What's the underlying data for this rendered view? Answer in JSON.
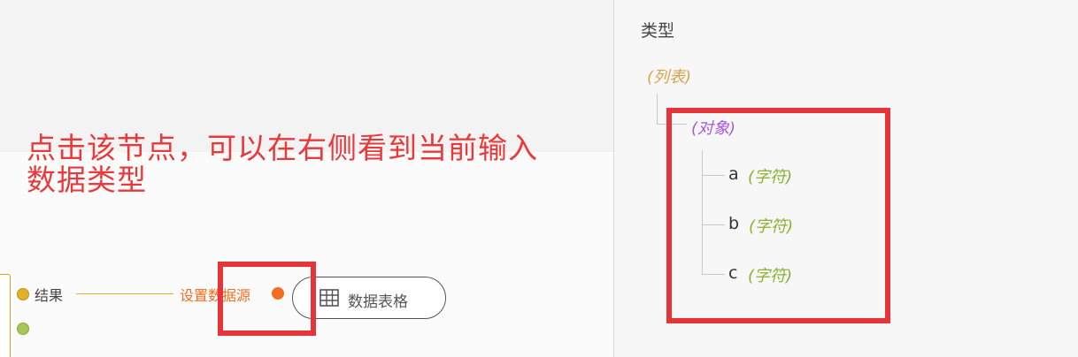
{
  "annotation": {
    "line1": "点击该节点，可以在右侧看到当前输入",
    "line2": "数据类型"
  },
  "canvas": {
    "port_result_label": "结果",
    "set_source_label": "设置数据源",
    "table_node_label": "数据表格",
    "table_icon": "table-icon"
  },
  "panel": {
    "title": "类型",
    "list_type": "(列表)",
    "object_type": "(对象)",
    "fields": [
      {
        "key": "a",
        "type": "(字符)"
      },
      {
        "key": "b",
        "type": "(字符)"
      },
      {
        "key": "c",
        "type": "(字符)"
      }
    ]
  },
  "colors": {
    "highlight": "#e53538",
    "list_type": "#d6a552",
    "object_type": "#a65bdc",
    "string_type": "#8ab02b",
    "set_source": "#f26d21"
  }
}
